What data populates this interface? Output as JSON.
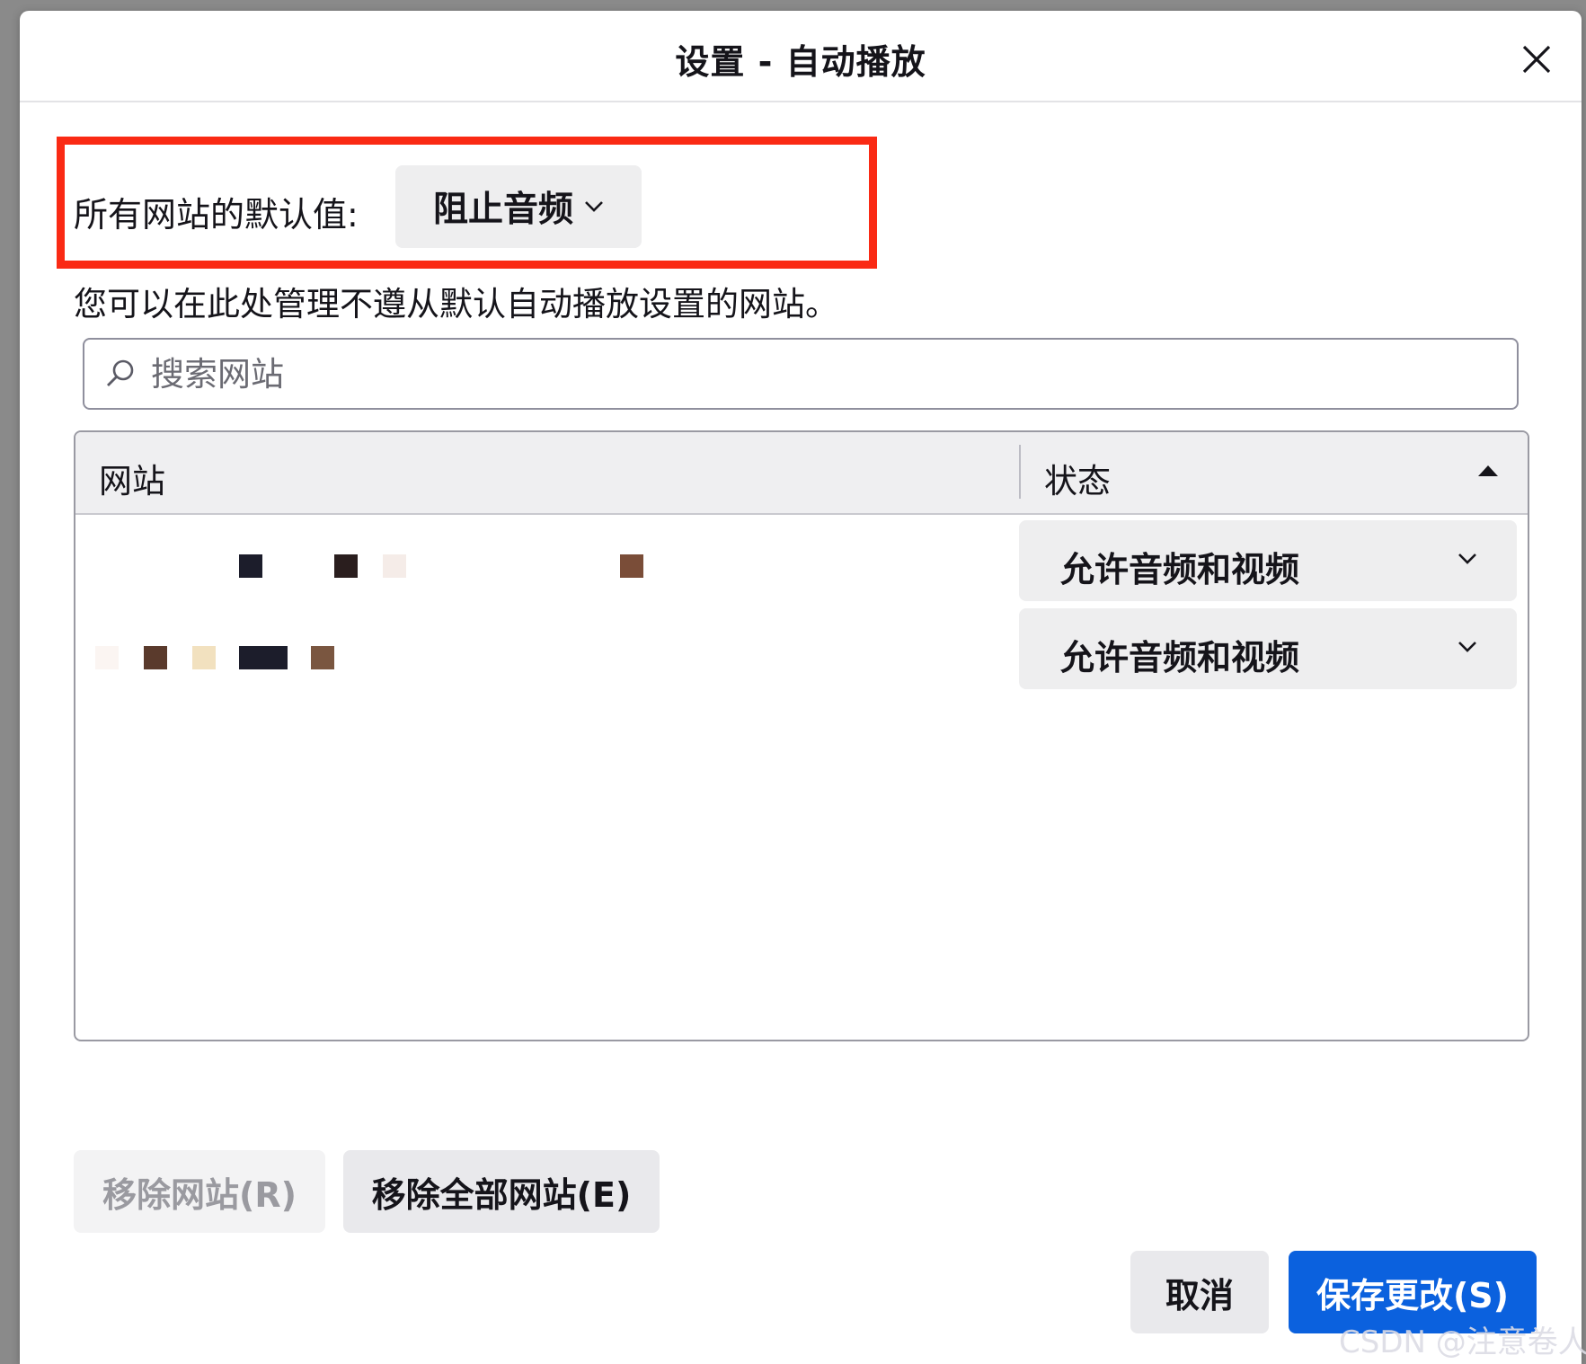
{
  "dialog": {
    "title": "设置 - 自动播放",
    "close_icon": "close-icon"
  },
  "default_setting": {
    "label": "所有网站的默认值:",
    "selected": "阻止音频"
  },
  "description": "您可以在此处管理不遵从默认自动播放设置的网站。",
  "search": {
    "placeholder": "搜索网站",
    "icon": "search-icon"
  },
  "table": {
    "columns": [
      "网站",
      "状态"
    ],
    "sort_icon": "sort-ascending-icon",
    "rows": [
      {
        "status": "允许音频和视频"
      },
      {
        "status": "允许音频和视频"
      }
    ]
  },
  "buttons": {
    "remove_site": "移除网站(R)",
    "remove_all": "移除全部网站(E)",
    "cancel": "取消",
    "save": "保存更改(S)"
  },
  "watermark": "CSDN @注意卷人",
  "colors": {
    "highlight": "#fa2a14",
    "primary": "#0b61de"
  }
}
